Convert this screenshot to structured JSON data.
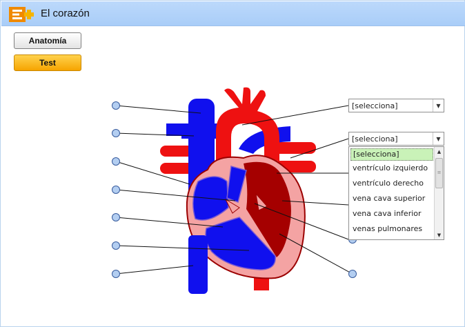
{
  "app": {
    "title": "El corazón"
  },
  "nav": {
    "anatomy_label": "Anatomía",
    "test_label": "Test"
  },
  "selects": [
    {
      "value": "[selecciona]"
    },
    {
      "value": "[selecciona]"
    }
  ],
  "dropdown": {
    "options": [
      "[selecciona]",
      "ventrículo izquierdo",
      "ventrículo derecho",
      "vena cava superior",
      "vena cava inferior",
      "venas pulmonares"
    ],
    "selected_index": 0
  },
  "colors": {
    "title_bar": "#bcd9fb",
    "test_button": "#f6a400",
    "oxygen_poor_blood": "#1010ee",
    "oxygen_rich_blood": "#ee1111",
    "heart_wall": "#f4a3a3",
    "dark_chamber": "#a50000",
    "label_dot": "#b3cef1",
    "selected_option": "#c9f2b8"
  }
}
